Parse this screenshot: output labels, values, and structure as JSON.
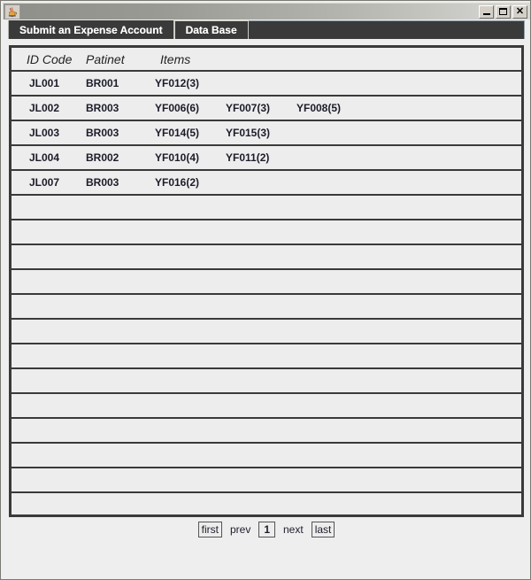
{
  "window": {
    "icon": "java-cup-icon",
    "title": "",
    "controls": {
      "minimize": "minimize-icon",
      "maximize": "maximize-icon",
      "close": "close-icon"
    }
  },
  "tabs": [
    {
      "label": "Submit an Expense Account",
      "selected": false
    },
    {
      "label": "Data Base",
      "selected": true
    }
  ],
  "table": {
    "columns": [
      "ID Code",
      "Patinet",
      "Items"
    ],
    "rows": [
      {
        "id": "JL001",
        "patient": "BR001",
        "items": [
          "YF012(3)"
        ]
      },
      {
        "id": "JL002",
        "patient": "BR003",
        "items": [
          "YF006(6)",
          "YF007(3)",
          "YF008(5)"
        ]
      },
      {
        "id": "JL003",
        "patient": "BR003",
        "items": [
          "YF014(5)",
          "YF015(3)"
        ]
      },
      {
        "id": "JL004",
        "patient": "BR002",
        "items": [
          "YF010(4)",
          "YF011(2)"
        ]
      },
      {
        "id": "JL007",
        "patient": "BR003",
        "items": [
          "YF016(2)"
        ]
      }
    ],
    "empty_row_count": 13
  },
  "pagination": {
    "first": "first",
    "prev": "prev",
    "current": "1",
    "next": "next",
    "last": "last"
  },
  "colors": {
    "tab_bg": "#3a3a3a",
    "tab_text": "#ffffff",
    "panel_bg": "#ededed",
    "grid_line": "#3a3a3a",
    "text": "#1c1c2a"
  }
}
